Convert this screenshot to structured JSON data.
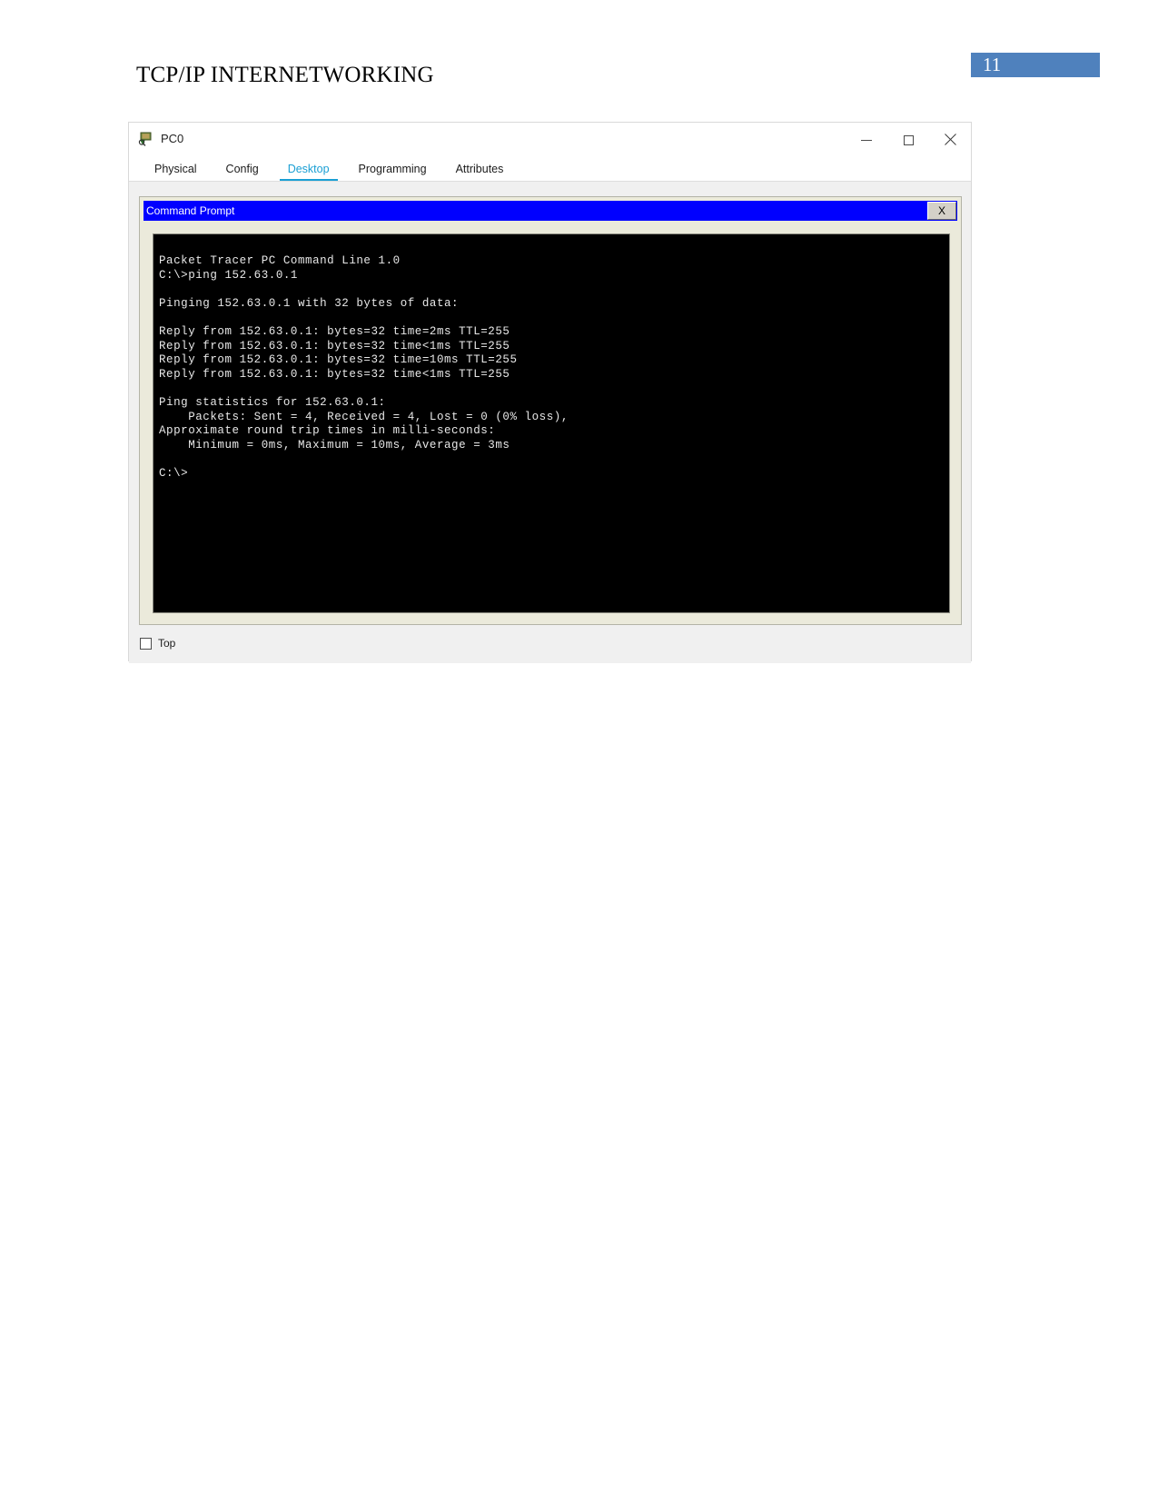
{
  "document": {
    "heading": "TCP/IP INTERNETWORKING",
    "page_number": "11",
    "page_badge_color": "#4f81bd"
  },
  "pt_window": {
    "title": "PC0",
    "app_icon": "packet-tracer-pc-icon",
    "controls": {
      "minimize": "—",
      "maximize": "□",
      "close": "✕"
    },
    "tabs": [
      {
        "label": "Physical",
        "active": false
      },
      {
        "label": "Config",
        "active": false
      },
      {
        "label": "Desktop",
        "active": true
      },
      {
        "label": "Programming",
        "active": false
      },
      {
        "label": "Attributes",
        "active": false
      }
    ],
    "active_tab_color": "#1a9fd4",
    "footer": {
      "checkbox_label": "Top",
      "checked": false
    }
  },
  "command_prompt": {
    "title": "Command Prompt",
    "titlebar_color": "#0000ff",
    "close_label": "X",
    "terminal": {
      "background": "#000000",
      "foreground": "#e8e8e8",
      "lines": [
        "Packet Tracer PC Command Line 1.0",
        "C:\\>ping 152.63.0.1",
        "",
        "Pinging 152.63.0.1 with 32 bytes of data:",
        "",
        "Reply from 152.63.0.1: bytes=32 time=2ms TTL=255",
        "Reply from 152.63.0.1: bytes=32 time<1ms TTL=255",
        "Reply from 152.63.0.1: bytes=32 time=10ms TTL=255",
        "Reply from 152.63.0.1: bytes=32 time<1ms TTL=255",
        "",
        "Ping statistics for 152.63.0.1:",
        "    Packets: Sent = 4, Received = 4, Lost = 0 (0% loss),",
        "Approximate round trip times in milli-seconds:",
        "    Minimum = 0ms, Maximum = 10ms, Average = 3ms",
        "",
        "C:\\>"
      ],
      "text": "Packet Tracer PC Command Line 1.0\nC:\\>ping 152.63.0.1\n\nPinging 152.63.0.1 with 32 bytes of data:\n\nReply from 152.63.0.1: bytes=32 time=2ms TTL=255\nReply from 152.63.0.1: bytes=32 time<1ms TTL=255\nReply from 152.63.0.1: bytes=32 time=10ms TTL=255\nReply from 152.63.0.1: bytes=32 time<1ms TTL=255\n\nPing statistics for 152.63.0.1:\n    Packets: Sent = 4, Received = 4, Lost = 0 (0% loss),\nApproximate round trip times in milli-seconds:\n    Minimum = 0ms, Maximum = 10ms, Average = 3ms\n\nC:\\>"
    }
  }
}
